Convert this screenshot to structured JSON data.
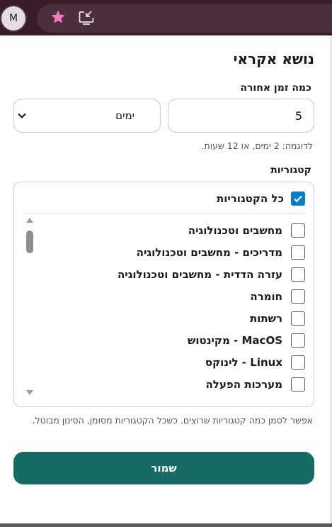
{
  "browser": {
    "profile_initial": "M",
    "icons": {
      "bookmark": "star-icon",
      "install": "install-app-icon"
    },
    "colors": {
      "toolbar": "#361d29",
      "star": "#f07cc3"
    }
  },
  "popup": {
    "title": "נושא אקראי",
    "since_label": "כמה זמן אחורה",
    "since_value": "5",
    "unit_selected": "ימים",
    "example_hint": "לדוגמה: 2 ימים, או 12 שעות.",
    "categories_label": "קטגוריות",
    "all_categories": {
      "label": "כל הקטגוריות",
      "checked": true
    },
    "categories": [
      {
        "label": "מחשבים וטכנולוגיה",
        "checked": false
      },
      {
        "label": "מדריכים - מחשבים וטכנולוגיה",
        "checked": false
      },
      {
        "label": "עזרה הדדית - מחשבים וטכנולוגיה",
        "checked": false
      },
      {
        "label": "חומרה",
        "checked": false
      },
      {
        "label": "רשתות",
        "checked": false
      },
      {
        "label": "MacOS - מקינטוש",
        "checked": false
      },
      {
        "label": "Linux - לינוקס",
        "checked": false
      },
      {
        "label": "מערכות הפעלה",
        "checked": false
      }
    ],
    "multi_hint": "אפשר לסמן כמה קטגוריות שרוצים. כשכל הקטגוריות מסומן, הסינון מבוטל.",
    "save_label": "שמור",
    "colors": {
      "accent": "#166c63",
      "checkbox": "#0a7ec2"
    }
  }
}
